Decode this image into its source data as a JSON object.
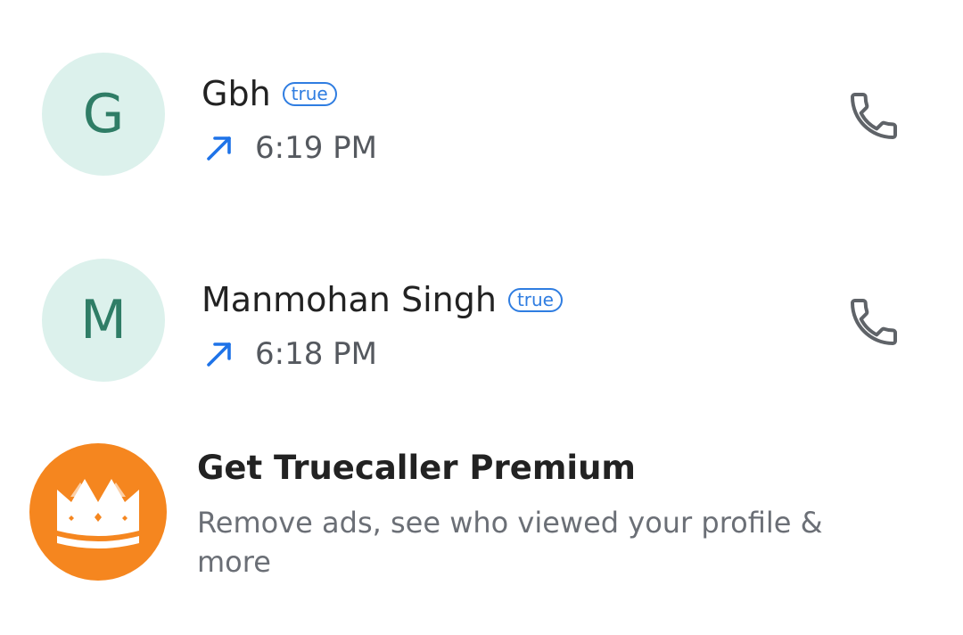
{
  "calls": [
    {
      "initial": "G",
      "name": "Gbh",
      "badge": "true",
      "time": "6:19 PM",
      "direction_icon": "outgoing-arrow-icon",
      "action_icon": "phone-icon"
    },
    {
      "initial": "M",
      "name": "Manmohan Singh",
      "badge": "true",
      "time": "6:18 PM",
      "direction_icon": "outgoing-arrow-icon",
      "action_icon": "phone-icon"
    }
  ],
  "promo": {
    "title": "Get Truecaller Premium",
    "subtitle": "Remove ads, see who viewed your profile & more",
    "icon": "crown-icon"
  },
  "colors": {
    "avatar_bg": "#dcf1ec",
    "avatar_text": "#2f7d66",
    "badge_blue": "#2f7de1",
    "outgoing_arrow": "#1e73e8",
    "phone_icon": "#5f6368",
    "promo_orange": "#f5861f"
  }
}
